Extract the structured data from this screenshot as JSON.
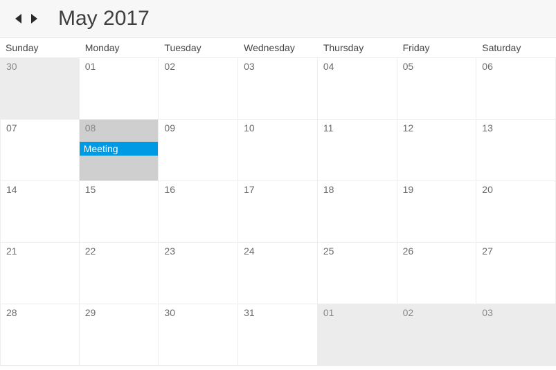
{
  "header": {
    "title": "May 2017"
  },
  "dayNames": [
    "Sunday",
    "Monday",
    "Tuesday",
    "Wednesday",
    "Thursday",
    "Friday",
    "Saturday"
  ],
  "colors": {
    "eventBg": "#009ae4"
  },
  "weeks": [
    [
      {
        "n": "30",
        "out": true
      },
      {
        "n": "01"
      },
      {
        "n": "02"
      },
      {
        "n": "03"
      },
      {
        "n": "04"
      },
      {
        "n": "05"
      },
      {
        "n": "06"
      }
    ],
    [
      {
        "n": "07"
      },
      {
        "n": "08",
        "selected": true,
        "events": [
          {
            "label": "Meeting"
          }
        ]
      },
      {
        "n": "09"
      },
      {
        "n": "10"
      },
      {
        "n": "11"
      },
      {
        "n": "12"
      },
      {
        "n": "13"
      }
    ],
    [
      {
        "n": "14"
      },
      {
        "n": "15"
      },
      {
        "n": "16"
      },
      {
        "n": "17"
      },
      {
        "n": "18"
      },
      {
        "n": "19"
      },
      {
        "n": "20"
      }
    ],
    [
      {
        "n": "21"
      },
      {
        "n": "22"
      },
      {
        "n": "23"
      },
      {
        "n": "24"
      },
      {
        "n": "25"
      },
      {
        "n": "26"
      },
      {
        "n": "27"
      }
    ],
    [
      {
        "n": "28"
      },
      {
        "n": "29"
      },
      {
        "n": "30"
      },
      {
        "n": "31"
      },
      {
        "n": "01",
        "out": true
      },
      {
        "n": "02",
        "out": true
      },
      {
        "n": "03",
        "out": true
      }
    ]
  ]
}
